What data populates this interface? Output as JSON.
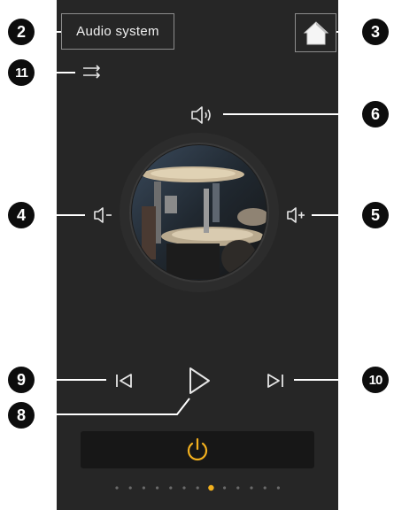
{
  "header": {
    "title": "Audio system",
    "home_icon": "home-icon"
  },
  "controls": {
    "menu_icon": "shuffle-icon",
    "mute_icon": "speaker-sound-icon",
    "volume_down_icon": "volume-down-icon",
    "volume_up_icon": "volume-up-icon",
    "previous_icon": "previous-track-icon",
    "play_icon": "play-icon",
    "next_icon": "next-track-icon",
    "power_icon": "power-icon"
  },
  "pagination": {
    "total": 13,
    "active_index": 7
  },
  "callouts": [
    "2",
    "3",
    "11",
    "6",
    "4",
    "5",
    "9",
    "10",
    "8"
  ],
  "colors": {
    "panel": "#262626",
    "power_accent": "#f2b01e",
    "active_dot": "#f2b01e",
    "icon": "#e6e6e6"
  }
}
